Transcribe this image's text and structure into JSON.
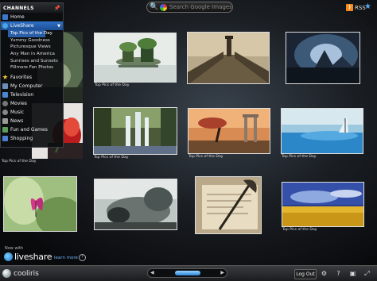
{
  "search": {
    "placeholder": "Search Google Images"
  },
  "rss": {
    "label": "RSS"
  },
  "sidebar": {
    "header": "CHANNELS",
    "items": [
      {
        "label": "Home",
        "icon": "home-icon",
        "color": "#3a78c9"
      },
      {
        "label": "LiveShare",
        "icon": "liveshare-icon",
        "color": "#47a6e8",
        "expanded": true
      },
      {
        "label": "Favorites",
        "icon": "star-icon",
        "color": "#f2c230"
      },
      {
        "label": "My Computer",
        "icon": "computer-icon",
        "color": "#6b8fb8"
      },
      {
        "label": "Television",
        "icon": "tv-icon",
        "color": "#4a86d1"
      },
      {
        "label": "Movies",
        "icon": "film-icon",
        "color": "#777777"
      },
      {
        "label": "Music",
        "icon": "music-icon",
        "color": "#888888"
      },
      {
        "label": "News",
        "icon": "news-icon",
        "color": "#9a9a9a"
      },
      {
        "label": "Fun and Games",
        "icon": "games-icon",
        "color": "#5aa05a"
      },
      {
        "label": "Shopping",
        "icon": "cart-icon",
        "color": "#4a80d0"
      }
    ],
    "liveshare_children": [
      "Top Pics of the Day",
      "Yummy Goodness",
      "Picturesque Views",
      "Any Man in America",
      "Sunrises and Sunsets",
      "Fillmore Fan Photos"
    ]
  },
  "captions": {
    "top_pics": "Top Pics of the Day"
  },
  "promo": {
    "now_with": "Now with",
    "brand": "liveshare",
    "learn_more": "learn more"
  },
  "bottom": {
    "brand": "cooliris",
    "logout": "Log Out"
  },
  "colors": {
    "accent": "#2e6fc4",
    "link": "#6fb3ff"
  }
}
